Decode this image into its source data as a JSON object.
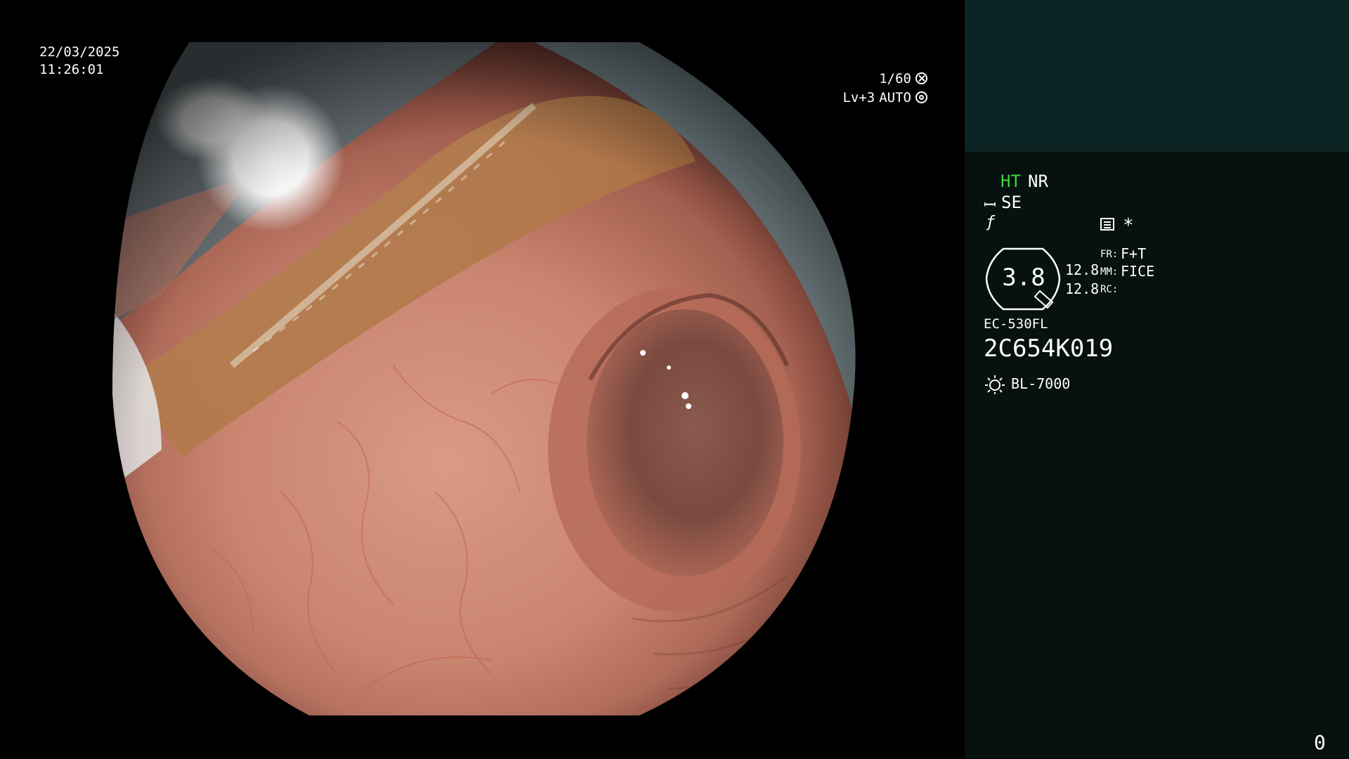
{
  "overlay": {
    "date": "22/03/2025",
    "time": "11:26:01",
    "shutter": "1/60",
    "level": "Lv+3",
    "exposure_mode": "AUTO"
  },
  "panel": {
    "ht": "HT",
    "nr": "NR",
    "se": "SE",
    "asterisk": "*",
    "zoom": "3.8",
    "param1": "12.8",
    "param2": "12.8",
    "fr_label": "FR:",
    "fr_value": "F+T",
    "mm_label": "MM:",
    "mm_value": "FICE",
    "rc_label": "RC:",
    "scope_model": "EC-530FL",
    "scope_serial": "2C654K019",
    "light_source": "BL-7000",
    "counter": "0"
  },
  "colors": {
    "background": "#000000",
    "panel_dark": "#071110",
    "panel_top": "#0c2323",
    "ht_green": "#3fd43f",
    "text": "#ffffff"
  },
  "icons": {
    "shutter": "aperture-cross-icon",
    "exposure": "concentric-circle-icon",
    "structure_enhance": "se-mode-icon",
    "freeze": "f-hook-icon",
    "menu": "menu-list-icon",
    "light": "sun-icon"
  }
}
